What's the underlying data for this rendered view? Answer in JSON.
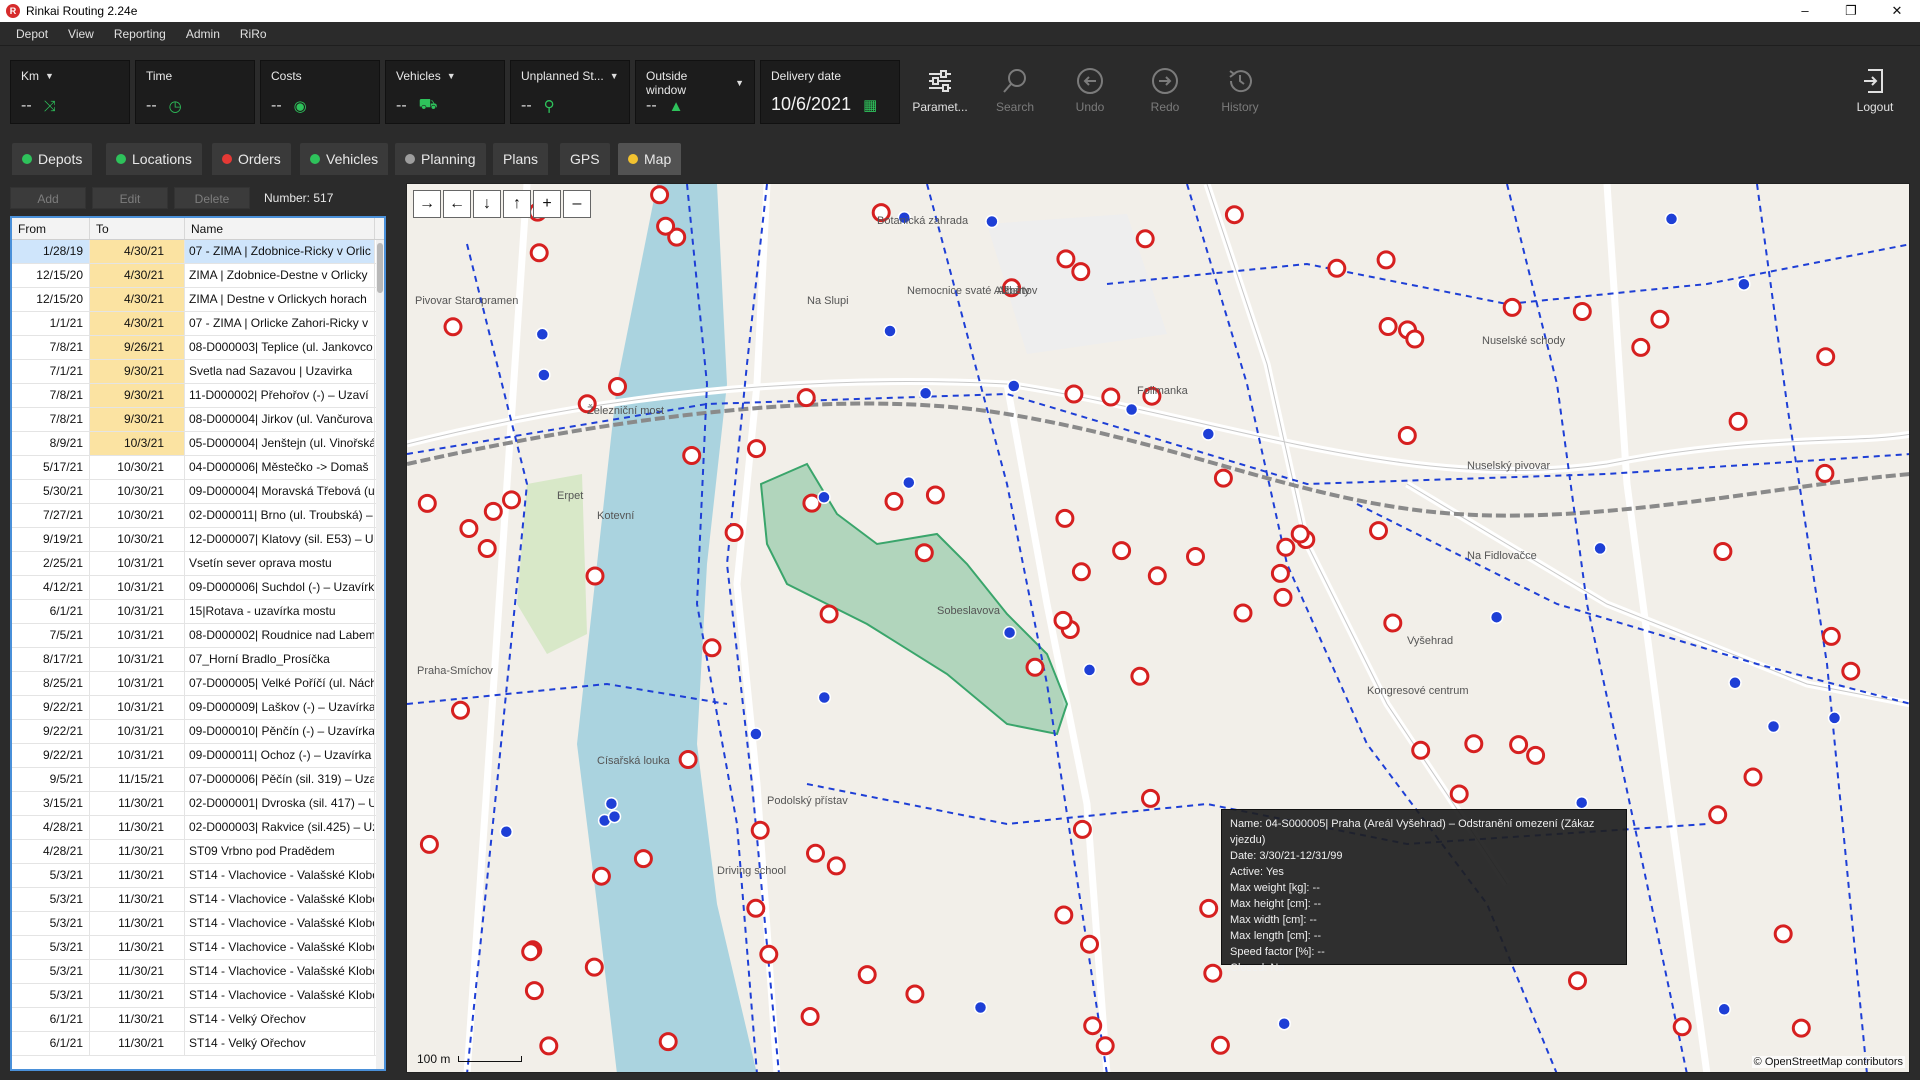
{
  "window": {
    "title": "Rinkai Routing 2.24e",
    "app_icon": "rinkai-logo-icon",
    "controls": [
      "–",
      "❐",
      "✕"
    ]
  },
  "menu": [
    "Depot",
    "View",
    "Reporting",
    "Admin",
    "RiRo"
  ],
  "kpis": [
    {
      "label": "Km",
      "value": "--",
      "dropdown": true,
      "icon": "route-icon"
    },
    {
      "label": "Time",
      "value": "--",
      "dropdown": false,
      "icon": "clock-icon"
    },
    {
      "label": "Costs",
      "value": "--",
      "dropdown": false,
      "icon": "coins-icon"
    },
    {
      "label": "Vehicles",
      "value": "--",
      "dropdown": true,
      "icon": "truck-icon"
    },
    {
      "label": "Unplanned St...",
      "value": "--",
      "dropdown": true,
      "icon": "pin-icon"
    },
    {
      "label": "Outside window",
      "value": "--",
      "dropdown": true,
      "icon": "warning-icon"
    }
  ],
  "delivery_date": {
    "label": "Delivery date",
    "value": "10/6/2021",
    "icon": "calendar-icon"
  },
  "tools": [
    {
      "label": "Paramet...",
      "icon": "sliders-icon",
      "enabled": true
    },
    {
      "label": "Search",
      "icon": "search-icon",
      "enabled": false
    },
    {
      "label": "Undo",
      "icon": "undo-icon",
      "enabled": false
    },
    {
      "label": "Redo",
      "icon": "redo-icon",
      "enabled": false
    },
    {
      "label": "History",
      "icon": "history-icon",
      "enabled": false
    }
  ],
  "logout": {
    "label": "Logout",
    "icon": "logout-icon"
  },
  "tabs": [
    {
      "label": "Depots",
      "dot": "#2ec25b"
    },
    {
      "label": "Locations",
      "dot": "#2ec25b"
    },
    {
      "label": "Orders",
      "dot": "#e53935"
    },
    {
      "label": "Vehicles",
      "dot": "#2ec25b"
    },
    {
      "label": "Planning",
      "dot": "#9e9e9e"
    },
    {
      "label": "Plans",
      "dot": null
    },
    {
      "label": "GPS",
      "dot": null
    },
    {
      "label": "Map",
      "dot": "#f2c230",
      "active": true
    }
  ],
  "list": {
    "add": "Add",
    "edit": "Edit",
    "delete": "Delete",
    "count": "Number: 517",
    "columns": [
      "From",
      "To",
      "Name"
    ],
    "rows": [
      {
        "from": "1/28/19",
        "to": "4/30/21",
        "name": "07 - ZIMA | Zdobnice-Ricky v Orlic",
        "hl": true
      },
      {
        "from": "12/15/20",
        "to": "4/30/21",
        "name": "ZIMA | Zdobnice-Destne v Orlicky",
        "hl": true
      },
      {
        "from": "12/15/20",
        "to": "4/30/21",
        "name": "ZIMA | Destne v Orlickych horach",
        "hl": true
      },
      {
        "from": "1/1/21",
        "to": "4/30/21",
        "name": "07 - ZIMA | Orlicke Zahori-Ricky v",
        "hl": true
      },
      {
        "from": "7/8/21",
        "to": "9/26/21",
        "name": "08-D000003| Teplice (ul. Jankovco",
        "hl": true
      },
      {
        "from": "7/1/21",
        "to": "9/30/21",
        "name": "Svetla nad Sazavou | Uzavirka",
        "hl": true
      },
      {
        "from": "7/8/21",
        "to": "9/30/21",
        "name": "11-D000002| Přehořov (-) – Uzaví",
        "hl": true
      },
      {
        "from": "7/8/21",
        "to": "9/30/21",
        "name": "08-D000004| Jirkov (ul. Vančurova",
        "hl": true
      },
      {
        "from": "8/9/21",
        "to": "10/3/21",
        "name": "05-D000004| Jenštejn (ul. Vinořská",
        "hl": true
      },
      {
        "from": "5/17/21",
        "to": "10/30/21",
        "name": "04-D000006| Městečko -> Domaš",
        "hl": false
      },
      {
        "from": "5/30/21",
        "to": "10/30/21",
        "name": "09-D000004| Moravská Třebová (u",
        "hl": false
      },
      {
        "from": "7/27/21",
        "to": "10/30/21",
        "name": "02-D000011| Brno (ul. Troubská) –",
        "hl": false
      },
      {
        "from": "9/19/21",
        "to": "10/30/21",
        "name": "12-D000007| Klatovy (sil. E53) – Uz",
        "hl": false
      },
      {
        "from": "2/25/21",
        "to": "10/31/21",
        "name": "Vsetín sever oprava mostu",
        "hl": false
      },
      {
        "from": "4/12/21",
        "to": "10/31/21",
        "name": "09-D000006| Suchdol (-) – Uzavírk",
        "hl": false
      },
      {
        "from": "6/1/21",
        "to": "10/31/21",
        "name": "15|Rotava - uzavírka mostu",
        "hl": false
      },
      {
        "from": "7/5/21",
        "to": "10/31/21",
        "name": "08-D000002| Roudnice nad Labem",
        "hl": false
      },
      {
        "from": "8/17/21",
        "to": "10/31/21",
        "name": "07_Horní Bradlo_Prosíčka",
        "hl": false
      },
      {
        "from": "8/25/21",
        "to": "10/31/21",
        "name": "07-D000005| Velké Poříčí (ul. Nách",
        "hl": false
      },
      {
        "from": "9/22/21",
        "to": "10/31/21",
        "name": "09-D000009| Laškov (-) – Uzavírka",
        "hl": false
      },
      {
        "from": "9/22/21",
        "to": "10/31/21",
        "name": "09-D000010| Pěnčín (-) – Uzavírka",
        "hl": false
      },
      {
        "from": "9/22/21",
        "to": "10/31/21",
        "name": "09-D000011| Ochoz (-) – Uzavírka",
        "hl": false
      },
      {
        "from": "9/5/21",
        "to": "11/15/21",
        "name": "07-D000006| Pěčín (sil. 319) – Uza",
        "hl": false
      },
      {
        "from": "3/15/21",
        "to": "11/30/21",
        "name": "02-D000001| Dvroska (sil. 417) – U",
        "hl": false
      },
      {
        "from": "4/28/21",
        "to": "11/30/21",
        "name": "02-D000003| Rakvice (sil.425) – Uz",
        "hl": false
      },
      {
        "from": "4/28/21",
        "to": "11/30/21",
        "name": "ST09 Vrbno pod Pradědem",
        "hl": false
      },
      {
        "from": "5/3/21",
        "to": "11/30/21",
        "name": "ST14 - Vlachovice - Valašské Klobo",
        "hl": false
      },
      {
        "from": "5/3/21",
        "to": "11/30/21",
        "name": "ST14 - Vlachovice - Valašské Klobo",
        "hl": false
      },
      {
        "from": "5/3/21",
        "to": "11/30/21",
        "name": "ST14 - Vlachovice - Valašské Klobo",
        "hl": false
      },
      {
        "from": "5/3/21",
        "to": "11/30/21",
        "name": "ST14 - Vlachovice - Valašské Klobo",
        "hl": false
      },
      {
        "from": "5/3/21",
        "to": "11/30/21",
        "name": "ST14 - Vlachovice - Valašské Klobo",
        "hl": false
      },
      {
        "from": "5/3/21",
        "to": "11/30/21",
        "name": "ST14 - Vlachovice - Valašské Klobo",
        "hl": false
      },
      {
        "from": "6/1/21",
        "to": "11/30/21",
        "name": "ST14 - Velký Ořechov",
        "hl": false
      },
      {
        "from": "6/1/21",
        "to": "11/30/21",
        "name": "ST14 - Velký Ořechov",
        "hl": false
      }
    ]
  },
  "map": {
    "controls": [
      "→",
      "←",
      "↓",
      "↑",
      "+",
      "–"
    ],
    "scale": "100 m",
    "attribution": "© OpenStreetMap contributors",
    "place_labels": [
      "Pivovar Staropramen",
      "Železniční most",
      "Erpet",
      "Kotevní",
      "Císařská louka",
      "Praha-Smíchov",
      "Botanická zahrada",
      "Nemocnice svaté Alžběty",
      "Albertov",
      "Folimanka",
      "Nuselský pivovar",
      "Vyšehrad",
      "Kongresové centrum",
      "Na Fidlovačce",
      "Podolský přístav",
      "Driving school",
      "Nuselské schody",
      "Na Slupi",
      "Sobeslavova"
    ],
    "restricted_zone_color": "#3aa56b",
    "marker_color": "#d62020",
    "route_color": "#1e3fd6",
    "tooltip": [
      "Name: 04-S000005| Praha (Areál Vyšehrad) – Odstranění omezení (Zákaz vjezdu)",
      "Date: 3/30/21-12/31/99",
      "Active: Yes",
      "Max weight [kg]: --",
      "Max height [cm]: --",
      "Max width [cm]: --",
      "Max length [cm]: --",
      "Speed factor [%]: --",
      "Closed: No"
    ]
  }
}
